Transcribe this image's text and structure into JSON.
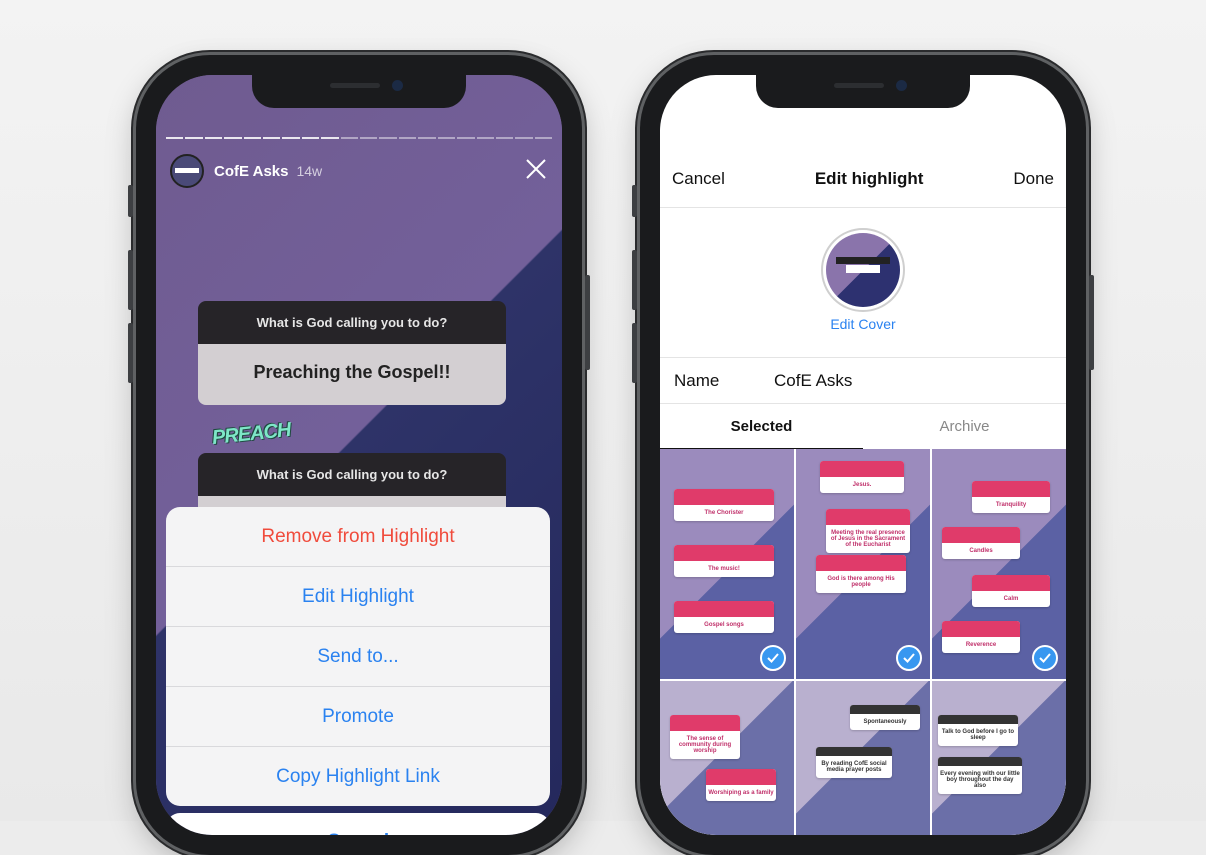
{
  "left_phone": {
    "story": {
      "account_name": "CofE Asks",
      "age": "14w",
      "cards": [
        {
          "question": "What is God calling you to do?",
          "answer": "Preaching the Gospel!!"
        },
        {
          "question": "What is God calling you to do?",
          "answer": ""
        }
      ],
      "sticker_text": "PREACH"
    },
    "action_sheet": {
      "items": [
        "Remove from Highlight",
        "Edit Highlight",
        "Send to...",
        "Promote",
        "Copy Highlight Link"
      ],
      "cancel_label": "Cancel"
    }
  },
  "right_phone": {
    "nav": {
      "cancel_label": "Cancel",
      "title": "Edit highlight",
      "done_label": "Done"
    },
    "edit_cover_label": "Edit Cover",
    "name_label": "Name",
    "name_value": "CofE Asks",
    "tabs": [
      "Selected",
      "Archive"
    ],
    "grid": [
      {
        "answers": [
          "The Chorister",
          "The music!",
          "Gospel songs"
        ],
        "selected": true
      },
      {
        "answers": [
          "Jesus.",
          "Meeting the real presence of Jesus in the Sacrament of the Eucharist",
          "God is there among His people"
        ],
        "selected": true
      },
      {
        "answers": [
          "Tranquility",
          "Candles",
          "Calm",
          "Reverence"
        ],
        "selected": true
      },
      {
        "answers": [
          "The sense of community during worship",
          "Worshiping as a family"
        ],
        "selected": false
      },
      {
        "answers": [
          "Spontaneously",
          "By reading CofE social media prayer posts"
        ],
        "selected": false
      },
      {
        "answers": [
          "Talk to God before I go to sleep",
          "Every evening with our little boy throughout the day also"
        ],
        "selected": false
      }
    ]
  },
  "colors": {
    "ios_blue": "#2a82f0",
    "destructive_red": "#f04b3c",
    "check_blue": "#3897f0"
  }
}
